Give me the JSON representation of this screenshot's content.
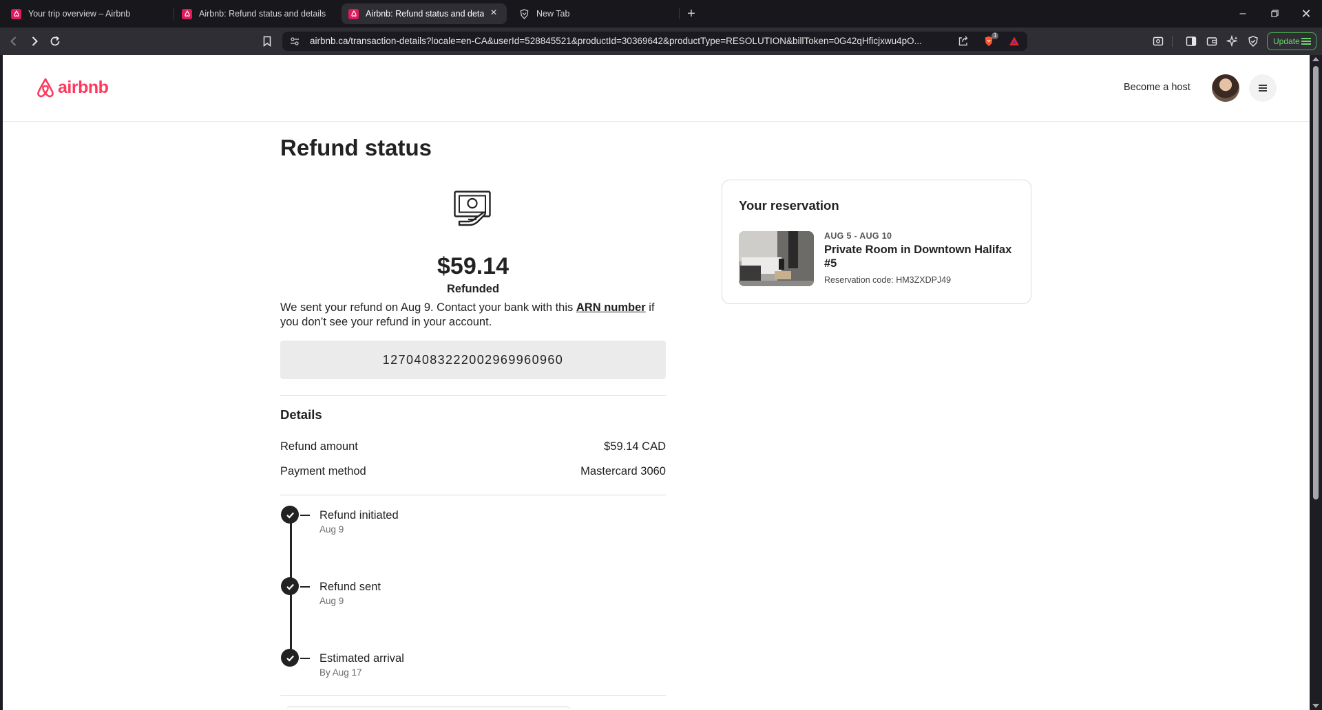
{
  "browser": {
    "tabs": [
      {
        "title": "Your trip overview – Airbnb"
      },
      {
        "title": "Airbnb: Refund status and details"
      },
      {
        "title": "Airbnb: Refund status and details"
      },
      {
        "title": "New Tab"
      }
    ],
    "url": "airbnb.ca/transaction-details?locale=en-CA&userId=528845521&productId=30369642&productType=RESOLUTION&billToken=0G42qHficjxwu4pO...",
    "shields_count": "1",
    "update_label": "Update"
  },
  "header": {
    "logo_text": "airbnb",
    "become_host": "Become a host"
  },
  "refund": {
    "page_title": "Refund status",
    "amount": "$59.14",
    "status": "Refunded",
    "desc_before": "We sent your refund on Aug 9. Contact your bank with this ",
    "arn_link": "ARN number",
    "desc_after": " if you don’t see your refund in your account.",
    "arn": "12704083222002969960960"
  },
  "details": {
    "title": "Details",
    "rows": [
      {
        "label": "Refund amount",
        "value": "$59.14 CAD"
      },
      {
        "label": "Payment method",
        "value": "Mastercard 3060"
      }
    ]
  },
  "timeline": [
    {
      "label": "Refund initiated",
      "date": "Aug 9"
    },
    {
      "label": "Refund sent",
      "date": "Aug 9"
    },
    {
      "label": "Estimated arrival",
      "date": "By Aug 17"
    }
  ],
  "reservation": {
    "title": "Your reservation",
    "dates": "AUG 5 - AUG 10",
    "name": "Private Room in Downtown Halifax #5",
    "code": "Reservation code: HM3ZXDPJ49"
  },
  "colors": {
    "brand": "#ff385c",
    "text": "#222222",
    "arn_bg": "#ebebeb"
  }
}
